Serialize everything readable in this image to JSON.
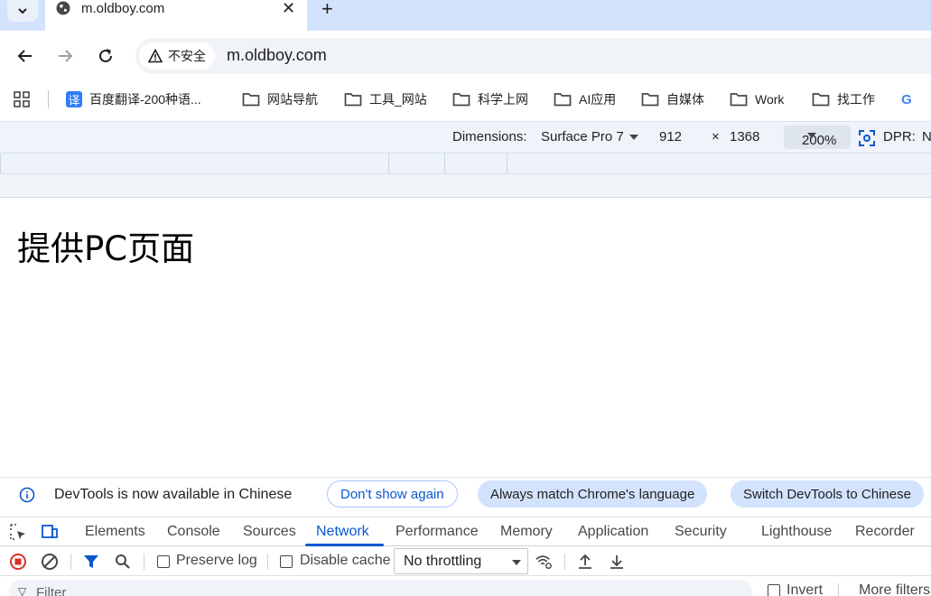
{
  "browser": {
    "tab": {
      "title": "m.oldboy.com"
    },
    "omnibox": {
      "security_label": "不安全",
      "url": "m.oldboy.com"
    },
    "bookmarks": [
      {
        "label": "百度翻译-200种语...",
        "icon": "fanyi-icon"
      },
      {
        "label": "网站导航",
        "icon": "folder-icon"
      },
      {
        "label": "工具_网站",
        "icon": "folder-icon"
      },
      {
        "label": "科学上网",
        "icon": "folder-icon"
      },
      {
        "label": "AI应用",
        "icon": "folder-icon"
      },
      {
        "label": "自媒体",
        "icon": "folder-icon"
      },
      {
        "label": "Work",
        "icon": "folder-icon"
      },
      {
        "label": "找工作",
        "icon": "folder-icon"
      },
      {
        "label": "G",
        "icon": "google-icon"
      }
    ]
  },
  "device_toolbar": {
    "dimensions_label": "Dimensions:",
    "device": "Surface Pro 7",
    "width": "912",
    "times": "×",
    "height": "1368",
    "zoom": "200%",
    "dpr_label": "DPR:",
    "dpr_value": "N"
  },
  "page": {
    "heading": "提供PC页面"
  },
  "infobar": {
    "message": "DevTools is now available in Chinese",
    "dont_show": "Don't show again",
    "always_match": "Always match Chrome's language",
    "switch": "Switch DevTools to Chinese"
  },
  "devtools": {
    "tabs": [
      "Elements",
      "Console",
      "Sources",
      "Network",
      "Performance",
      "Memory",
      "Application",
      "Security",
      "Lighthouse",
      "Recorder"
    ],
    "active_tab": "Network",
    "network": {
      "preserve_log": "Preserve log",
      "disable_cache": "Disable cache",
      "throttling": "No throttling",
      "filter_placeholder": "Filter",
      "invert": "Invert",
      "more_filters": "More filters"
    }
  },
  "colors": {
    "accent": "#0b57d0",
    "tabstrip": "#d3e3fd",
    "record_red": "#d93025"
  }
}
